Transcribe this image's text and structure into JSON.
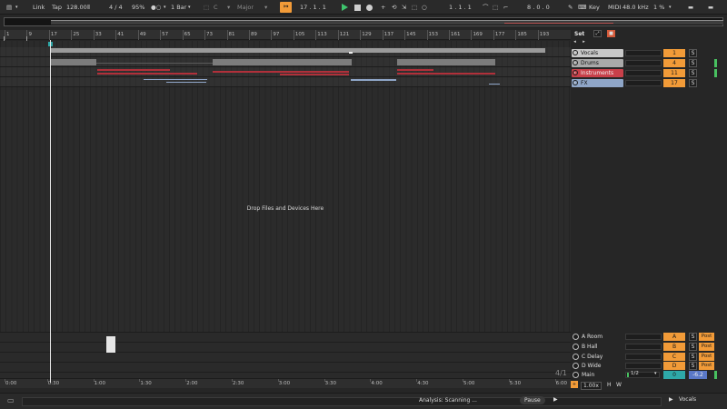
{
  "transport": {
    "link": "Link",
    "tap": "Tap",
    "tempo": "128.00",
    "time_signature": "4 / 4",
    "cpu": "95%",
    "quantize": "1 Bar",
    "key_root": "C",
    "scale": "Major",
    "position": "17 .  1 .  1",
    "loop_start": "1 .  1 .  1",
    "loop_length": "8 .  0 .  0",
    "key_label": "Key",
    "midi_label": "MIDI",
    "sample_rate": "48.0 kHz",
    "cpu_load": "1 %"
  },
  "ruler": {
    "bars": [
      "1",
      "9",
      "17",
      "25",
      "33",
      "41",
      "49",
      "57",
      "65",
      "73",
      "81",
      "89",
      "97",
      "105",
      "113",
      "121",
      "129",
      "137",
      "145",
      "153",
      "161",
      "169",
      "177",
      "185",
      "193"
    ]
  },
  "set_label": "Set",
  "tracks": [
    {
      "name": "Vocals",
      "color": "#c8c8c8",
      "number": "1",
      "solo": "S"
    },
    {
      "name": "Drums",
      "color": "#a9a9a9",
      "number": "4",
      "solo": "S"
    },
    {
      "name": "Instruments",
      "color": "#c8404a",
      "number": "11",
      "solo": "S"
    },
    {
      "name": "FX",
      "color": "#8fa6c8",
      "number": "17",
      "solo": "S"
    }
  ],
  "drop_hint": "Drop Files and Devices Here",
  "returns": [
    {
      "name": "A Room",
      "letter": "A",
      "solo": "S",
      "post": "Post"
    },
    {
      "name": "B Hall",
      "letter": "B",
      "solo": "S",
      "post": "Post"
    },
    {
      "name": "C Delay",
      "letter": "C",
      "solo": "S",
      "post": "Post"
    },
    {
      "name": "D Wide",
      "letter": "D",
      "solo": "S",
      "post": "Post"
    }
  ],
  "main": {
    "name": "Main",
    "routing": "1/2",
    "value": "0",
    "volume": "-6.2"
  },
  "time_ruler": [
    "0:00",
    "0:30",
    "1:00",
    "1:30",
    "2:00",
    "2:30",
    "3:00",
    "3:30",
    "4:00",
    "4:30",
    "5:00",
    "5:30",
    "6:00"
  ],
  "time_sig_display": "4/1",
  "zoom": "1.00x",
  "hw": {
    "h": "H",
    "w": "W"
  },
  "status": {
    "analysis": "Analysis: Scanning ...",
    "pause": "Pause",
    "selected_track": "Vocals"
  },
  "colors": {
    "accent": "#f29b38",
    "play": "#3ec46d",
    "instruments": "#c8404a",
    "fx": "#8fa6c8"
  }
}
